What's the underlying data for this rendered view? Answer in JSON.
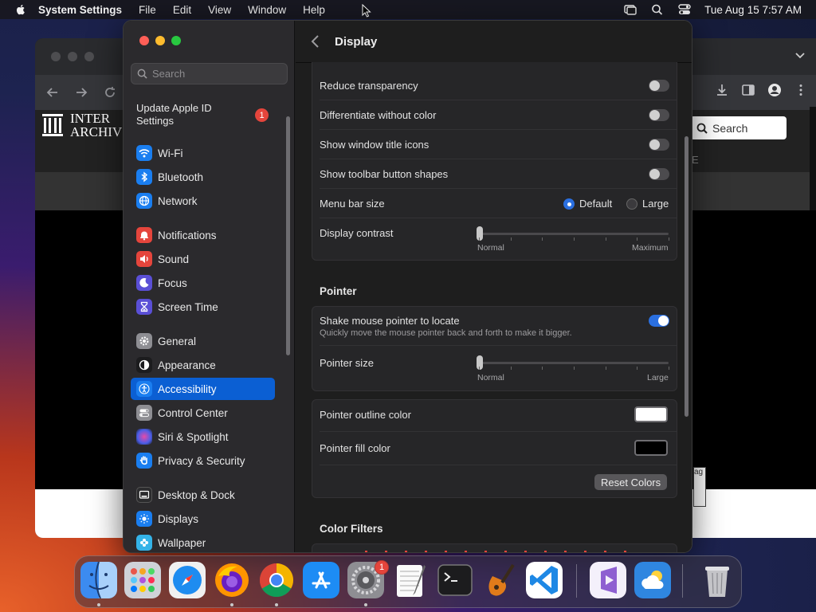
{
  "menubar": {
    "app": "System Settings",
    "menus": [
      "File",
      "Edit",
      "View",
      "Window",
      "Help"
    ],
    "clock": "Tue Aug 15  7:57 AM"
  },
  "browser": {
    "logo_line1": "INTER",
    "logo_line2": "ARCHIV",
    "search_label": "Search",
    "sub_letter": "E",
    "fav_text": "ag"
  },
  "sidebar": {
    "search_placeholder": "Search",
    "apple_id_label": "Update Apple ID Settings",
    "apple_id_badge": "1",
    "items": [
      {
        "label": "Wi-Fi",
        "icon": "wifi-icon",
        "color": "#1a7ef0"
      },
      {
        "label": "Bluetooth",
        "icon": "bluetooth-icon",
        "color": "#1a7ef0"
      },
      {
        "label": "Network",
        "icon": "globe-icon",
        "color": "#1a7ef0"
      },
      {
        "label": "Notifications",
        "icon": "bell-icon",
        "color": "#e5453c"
      },
      {
        "label": "Sound",
        "icon": "speaker-icon",
        "color": "#e5453c"
      },
      {
        "label": "Focus",
        "icon": "moon-icon",
        "color": "#5a4fd6"
      },
      {
        "label": "Screen Time",
        "icon": "hourglass-icon",
        "color": "#5a4fd6"
      },
      {
        "label": "General",
        "icon": "gear-icon",
        "color": "#8e8e93"
      },
      {
        "label": "Appearance",
        "icon": "appearance-icon",
        "color": "#1c1c1e"
      },
      {
        "label": "Accessibility",
        "icon": "accessibility-icon",
        "color": "#1a7ef0"
      },
      {
        "label": "Control Center",
        "icon": "switches-icon",
        "color": "#8e8e93"
      },
      {
        "label": "Siri & Spotlight",
        "icon": "siri-icon",
        "color": "#7d3cd8"
      },
      {
        "label": "Privacy & Security",
        "icon": "hand-icon",
        "color": "#1a7ef0"
      },
      {
        "label": "Desktop & Dock",
        "icon": "dock-icon",
        "color": "#2c2c2e"
      },
      {
        "label": "Displays",
        "icon": "sun-icon",
        "color": "#1a7ef0"
      },
      {
        "label": "Wallpaper",
        "icon": "flower-icon",
        "color": "#34b3e8"
      }
    ],
    "active_item": "Accessibility"
  },
  "main": {
    "title": "Display",
    "rows": {
      "reduce_transparency": "Reduce transparency",
      "differentiate": "Differentiate without color",
      "window_title_icons": "Show window title icons",
      "toolbar_shapes": "Show toolbar button shapes",
      "menu_bar_size": "Menu bar size",
      "menu_bar_default": "Default",
      "menu_bar_large": "Large",
      "display_contrast": "Display contrast",
      "contrast_min": "Normal",
      "contrast_max": "Maximum"
    },
    "toggles": {
      "reduce_transparency": false,
      "differentiate": false,
      "window_title_icons": false,
      "toolbar_shapes": false,
      "shake_pointer": true
    },
    "menu_bar_selected": "Default",
    "display_contrast_value": 0,
    "pointer_section": "Pointer",
    "pointer": {
      "shake_label": "Shake mouse pointer to locate",
      "shake_desc": "Quickly move the mouse pointer back and forth to make it bigger.",
      "size_label": "Pointer size",
      "size_min": "Normal",
      "size_max": "Large",
      "size_value": 0,
      "outline_label": "Pointer outline color",
      "outline_color": "#ffffff",
      "fill_label": "Pointer fill color",
      "fill_color": "#000000",
      "reset_button": "Reset Colors"
    },
    "color_filters_section": "Color Filters"
  },
  "dock": {
    "apps": [
      "Finder",
      "Launchpad",
      "Safari",
      "Firefox",
      "Chrome",
      "App Store",
      "System Settings",
      "TextEdit",
      "Terminal",
      "GarageBand",
      "Visual Studio Code",
      "Visual Studio",
      "Weather",
      "Trash"
    ],
    "settings_badge": "1"
  }
}
